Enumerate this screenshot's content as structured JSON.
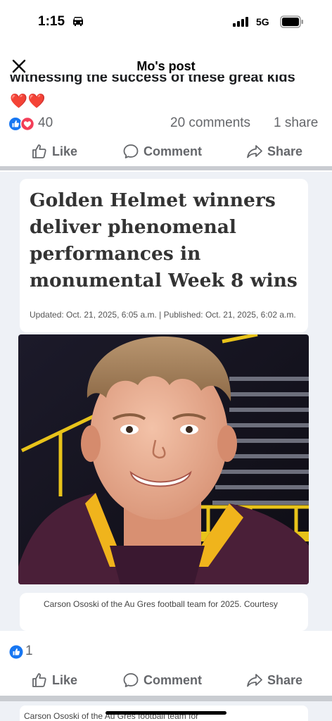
{
  "status_bar": {
    "time": "1:15",
    "network": "5G",
    "icons": [
      "car-icon",
      "signal-icon",
      "battery-icon"
    ]
  },
  "header": {
    "title": "Mo's post",
    "close_icon": "close-icon"
  },
  "post": {
    "cut_text": "witnessing the success of these great kids",
    "hearts": "❤️❤️",
    "reactions": {
      "icons": [
        "like-icon",
        "love-icon"
      ],
      "count": "40"
    },
    "comments": "20 comments",
    "shares": "1 share"
  },
  "actions": {
    "like": "Like",
    "comment": "Comment",
    "share": "Share"
  },
  "article": {
    "headline": "Golden Helmet winners deliver phenomenal performances in monumental Week 8 wins",
    "dateline": "Updated: Oct. 21, 2025, 6:05 a.m. | Published: Oct. 21, 2025, 6:02 a.m.",
    "caption": "Carson Ososki of the Au Gres football team for 2025. Courtesy"
  },
  "second_item": {
    "like_count": "1"
  },
  "next_post": {
    "caption_fragment": "Carson Ososki of the Au Gres football team for"
  },
  "colors": {
    "facebook_blue": "#1877f2",
    "love_red": "#f33e58",
    "secondary_text": "#65676b",
    "divider": "#c9ccd1",
    "media_background": "#eef1f6"
  }
}
